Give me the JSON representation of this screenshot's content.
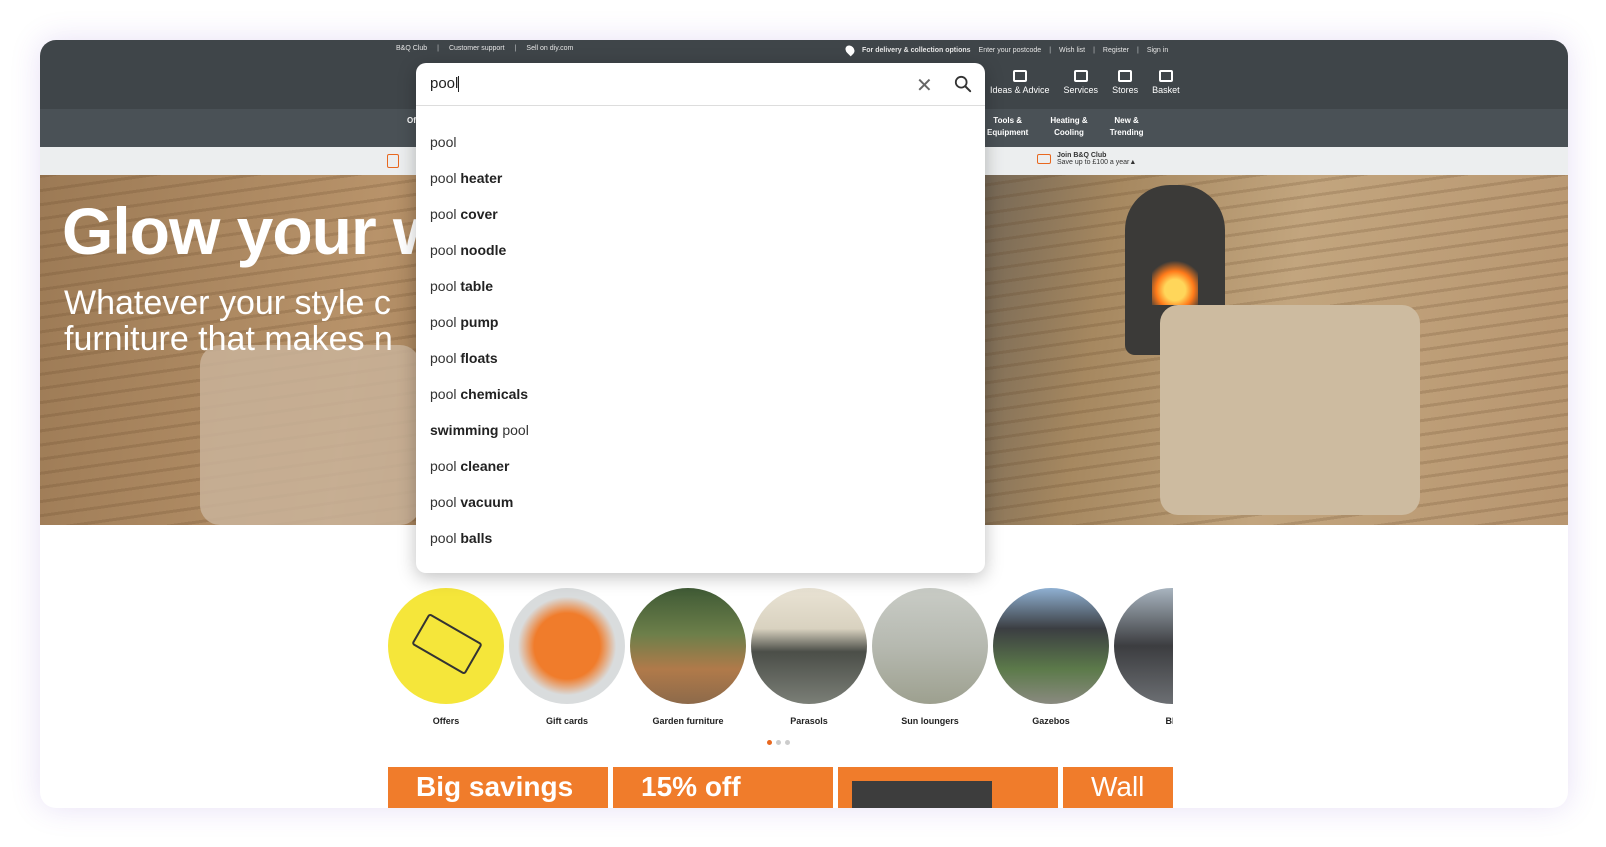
{
  "topbar": {
    "left_links": [
      "B&Q Club",
      "Customer support",
      "Sell on diy.com"
    ],
    "delivery_label": "For delivery & collection options",
    "postcode_prompt": "Enter your postcode",
    "right_links": [
      "Wish list",
      "Register",
      "Sign in"
    ]
  },
  "header_nav": [
    {
      "label": "Ideas & Advice",
      "icon": "idea-icon"
    },
    {
      "label": "Services",
      "icon": "tools-icon"
    },
    {
      "label": "Stores",
      "icon": "store-icon"
    },
    {
      "label": "Basket",
      "icon": "basket-icon"
    }
  ],
  "categories": [
    {
      "line1": "Tools &",
      "line2": "Equipment"
    },
    {
      "line1": "Heating &",
      "line2": "Cooling"
    },
    {
      "line1": "New &",
      "line2": "Trending"
    }
  ],
  "categories_partial": "Of",
  "promo": {
    "club_title": "Join B&Q Club",
    "club_sub": "Save up to £100 a year▲"
  },
  "hero": {
    "title": "Glow your w",
    "subtitle_line1": "Whatever your style c",
    "subtitle_line2": "furniture that makes n"
  },
  "search": {
    "value": "pool",
    "suggestions": [
      {
        "prefix": "pool",
        "bold": ""
      },
      {
        "prefix": "pool ",
        "bold": "heater"
      },
      {
        "prefix": "pool ",
        "bold": "cover"
      },
      {
        "prefix": "pool ",
        "bold": "noodle"
      },
      {
        "prefix": "pool ",
        "bold": "table"
      },
      {
        "prefix": "pool ",
        "bold": "pump"
      },
      {
        "prefix": "pool ",
        "bold": "floats"
      },
      {
        "prefix": "pool ",
        "bold": "chemicals"
      },
      {
        "prefix": "",
        "bold": "swimming",
        "suffix": " pool"
      },
      {
        "prefix": "pool ",
        "bold": "cleaner"
      },
      {
        "prefix": "pool ",
        "bold": "vacuum"
      },
      {
        "prefix": "pool ",
        "bold": "balls"
      }
    ]
  },
  "shop_categories": [
    {
      "label": "Offers"
    },
    {
      "label": "Gift cards"
    },
    {
      "label": "Garden furniture"
    },
    {
      "label": "Parasols"
    },
    {
      "label": "Sun loungers"
    },
    {
      "label": "Gazebos"
    },
    {
      "label": "BB"
    }
  ],
  "banners": [
    "Big savings",
    "15% off",
    "",
    "Wall"
  ],
  "colors": {
    "brand_orange": "#e8681f",
    "header_dark": "#3f4549"
  }
}
